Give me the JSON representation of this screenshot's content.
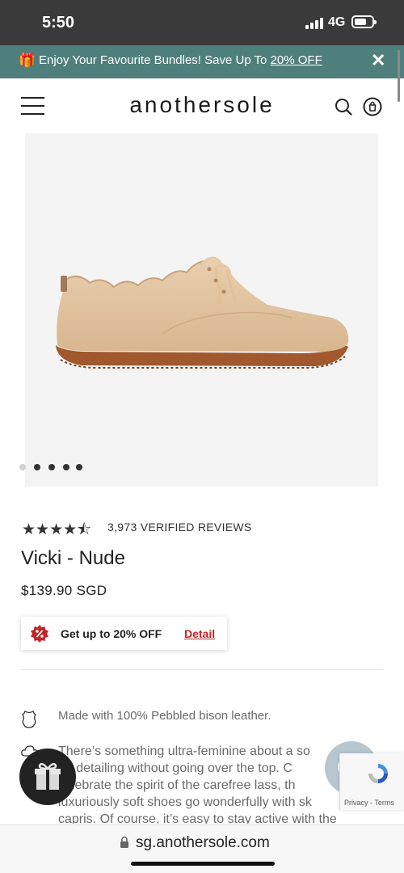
{
  "status_bar": {
    "time": "5:50",
    "network": "4G"
  },
  "promo": {
    "text": "Enjoy Your Favourite Bundles! Save Up To ",
    "link": "20% OFF",
    "close": "✕"
  },
  "header": {
    "logo": "anothersole"
  },
  "carousel": {
    "dot_count": 5,
    "active_index": 1
  },
  "product": {
    "rating_value": 4.5,
    "stars": "★★★★⯪",
    "reviews_label": "3,973 VERIFIED REVIEWS",
    "title": "Vicki - Nude",
    "price": "$139.90 SGD"
  },
  "discount": {
    "text": "Get up to 20% OFF",
    "link": "Detail"
  },
  "features": {
    "leather": "Made with 100% Pebbled bison leather.",
    "description_lines": [
      "There’s something ultra-feminine about a so",
      "ge detailing without going over the top. C",
      "celebrate the spirit of the carefree lass, th",
      "luxuriously soft shoes go wonderfully with sk",
      "capris. Of course, it’s easy to stay active with the"
    ]
  },
  "recaptcha": {
    "text": "Privacy - Terms"
  },
  "browser": {
    "url": "sg.anothersole.com"
  },
  "colors": {
    "promo_bg": "#4f7f7c",
    "discount_red": "#c0242a",
    "status_bg": "#3a3a3a"
  }
}
